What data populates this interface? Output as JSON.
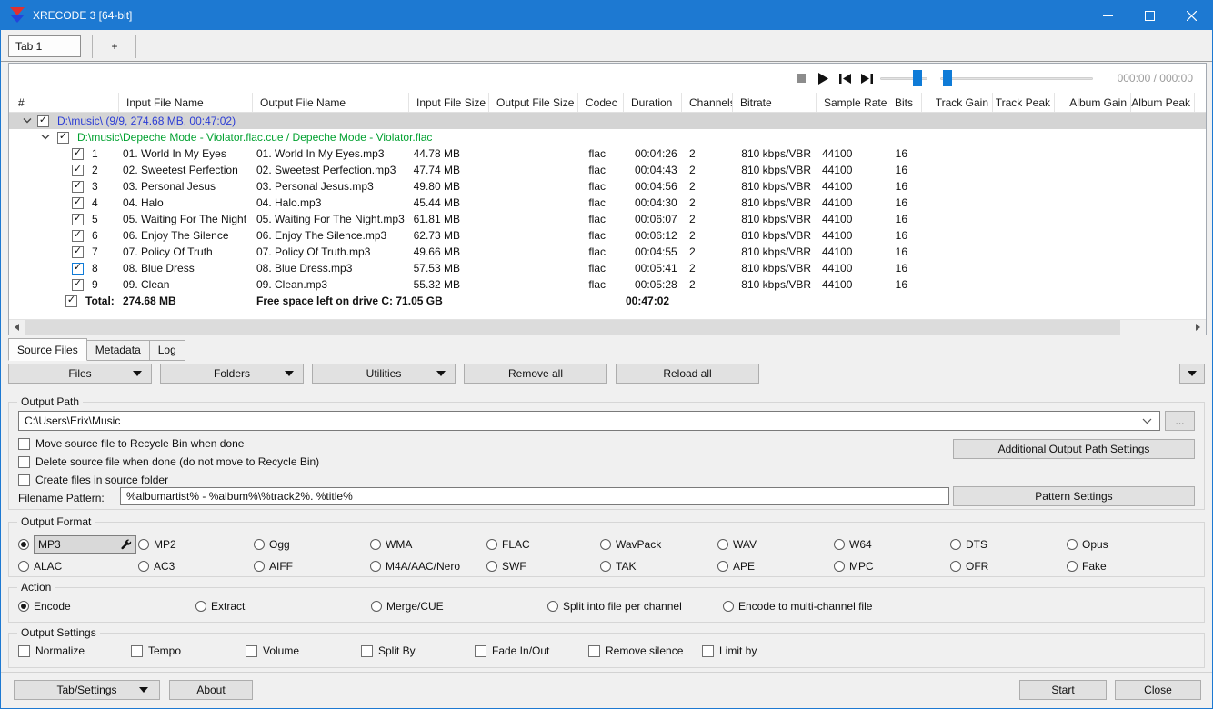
{
  "titlebar": {
    "title": "XRECODE 3 [64-bit]"
  },
  "tabstrip": {
    "tab1": "Tab 1",
    "add_tab": "+"
  },
  "player": {
    "time": "000:00 / 000:00"
  },
  "table": {
    "columns": [
      "#",
      "Input File Name",
      "Output File Name",
      "Input File Size",
      "Output File Size",
      "Codec",
      "Duration",
      "Channels",
      "Bitrate",
      "Sample Rate",
      "Bits",
      "Track Gain",
      "Track Peak",
      "Album Gain",
      "Album Peak"
    ],
    "group_dir": "D:\\music\\ (9/9, 274.68 MB, 00:47:02)",
    "group_cue": "D:\\music\\Depeche Mode - Violator.flac.cue / Depeche Mode - Violator.flac",
    "tracks": [
      {
        "num": "1",
        "input": "01. World In My Eyes",
        "output": "01. World In My Eyes.mp3",
        "input_size": "44.78 MB",
        "codec": "flac",
        "duration": "00:04:26",
        "channels": "2",
        "bitrate": "810 kbps/VBR",
        "sample_rate": "44100",
        "bits": "16"
      },
      {
        "num": "2",
        "input": "02. Sweetest Perfection",
        "output": "02. Sweetest Perfection.mp3",
        "input_size": "47.74 MB",
        "codec": "flac",
        "duration": "00:04:43",
        "channels": "2",
        "bitrate": "810 kbps/VBR",
        "sample_rate": "44100",
        "bits": "16"
      },
      {
        "num": "3",
        "input": "03. Personal Jesus",
        "output": "03. Personal Jesus.mp3",
        "input_size": "49.80 MB",
        "codec": "flac",
        "duration": "00:04:56",
        "channels": "2",
        "bitrate": "810 kbps/VBR",
        "sample_rate": "44100",
        "bits": "16"
      },
      {
        "num": "4",
        "input": "04. Halo",
        "output": "04. Halo.mp3",
        "input_size": "45.44 MB",
        "codec": "flac",
        "duration": "00:04:30",
        "channels": "2",
        "bitrate": "810 kbps/VBR",
        "sample_rate": "44100",
        "bits": "16"
      },
      {
        "num": "5",
        "input": "05. Waiting For The Night",
        "output": "05. Waiting For The Night.mp3",
        "input_size": "61.81 MB",
        "codec": "flac",
        "duration": "00:06:07",
        "channels": "2",
        "bitrate": "810 kbps/VBR",
        "sample_rate": "44100",
        "bits": "16"
      },
      {
        "num": "6",
        "input": "06. Enjoy The Silence",
        "output": "06. Enjoy The Silence.mp3",
        "input_size": "62.73 MB",
        "codec": "flac",
        "duration": "00:06:12",
        "channels": "2",
        "bitrate": "810 kbps/VBR",
        "sample_rate": "44100",
        "bits": "16"
      },
      {
        "num": "7",
        "input": "07. Policy Of Truth",
        "output": "07. Policy Of Truth.mp3",
        "input_size": "49.66 MB",
        "codec": "flac",
        "duration": "00:04:55",
        "channels": "2",
        "bitrate": "810 kbps/VBR",
        "sample_rate": "44100",
        "bits": "16"
      },
      {
        "num": "8",
        "input": "08. Blue Dress",
        "output": "08. Blue Dress.mp3",
        "input_size": "57.53 MB",
        "codec": "flac",
        "duration": "00:05:41",
        "channels": "2",
        "bitrate": "810 kbps/VBR",
        "sample_rate": "44100",
        "bits": "16",
        "focused": true
      },
      {
        "num": "9",
        "input": "09. Clean",
        "output": "09. Clean.mp3",
        "input_size": "55.32 MB",
        "codec": "flac",
        "duration": "00:05:28",
        "channels": "2",
        "bitrate": "810 kbps/VBR",
        "sample_rate": "44100",
        "bits": "16"
      }
    ],
    "total": {
      "label": "Total:",
      "size": "274.68 MB",
      "free_space": "Free space left on drive C: 71.05 GB",
      "duration": "00:47:02"
    }
  },
  "view_tabs": {
    "source_files": "Source Files",
    "metadata": "Metadata",
    "log": "Log"
  },
  "toolbar": {
    "files": "Files",
    "folders": "Folders",
    "utilities": "Utilities",
    "remove_all": "Remove all",
    "reload_all": "Reload all"
  },
  "output_path": {
    "label": "Output Path",
    "path": "C:\\Users\\Erix\\Music",
    "browse": "...",
    "recycle": "Move source file to Recycle Bin when done",
    "delete": "Delete source file when done (do not move to Recycle Bin)",
    "source_folder": "Create files in source folder",
    "additional": "Additional Output Path Settings",
    "pattern_label": "Filename Pattern:",
    "pattern": "%albumartist% - %album%\\%track2%. %title%",
    "pattern_settings": "Pattern Settings"
  },
  "output_format": {
    "label": "Output Format",
    "selected": "MP3",
    "formats": [
      "MP3",
      "MP2",
      "Ogg",
      "WMA",
      "FLAC",
      "WavPack",
      "WAV",
      "W64",
      "DTS",
      "Opus",
      "ALAC",
      "AC3",
      "AIFF",
      "M4A/AAC/Nero",
      "SWF",
      "TAK",
      "APE",
      "MPC",
      "OFR",
      "Fake"
    ]
  },
  "action": {
    "label": "Action",
    "selected": "Encode",
    "options": [
      "Encode",
      "Extract",
      "Merge/CUE",
      "Split into file per channel",
      "Encode to multi-channel file"
    ]
  },
  "output_settings": {
    "label": "Output Settings",
    "options": [
      "Normalize",
      "Tempo",
      "Volume",
      "Split By",
      "Fade In/Out",
      "Remove silence",
      "Limit by"
    ]
  },
  "bottombar": {
    "tab_settings": "Tab/Settings",
    "about": "About",
    "start": "Start",
    "close": "Close"
  },
  "colors": {
    "titlebar": "#1d79d2",
    "accent": "#0f7bd7",
    "dir_text": "#2b3cd5",
    "cue_text": "#00a12f"
  }
}
